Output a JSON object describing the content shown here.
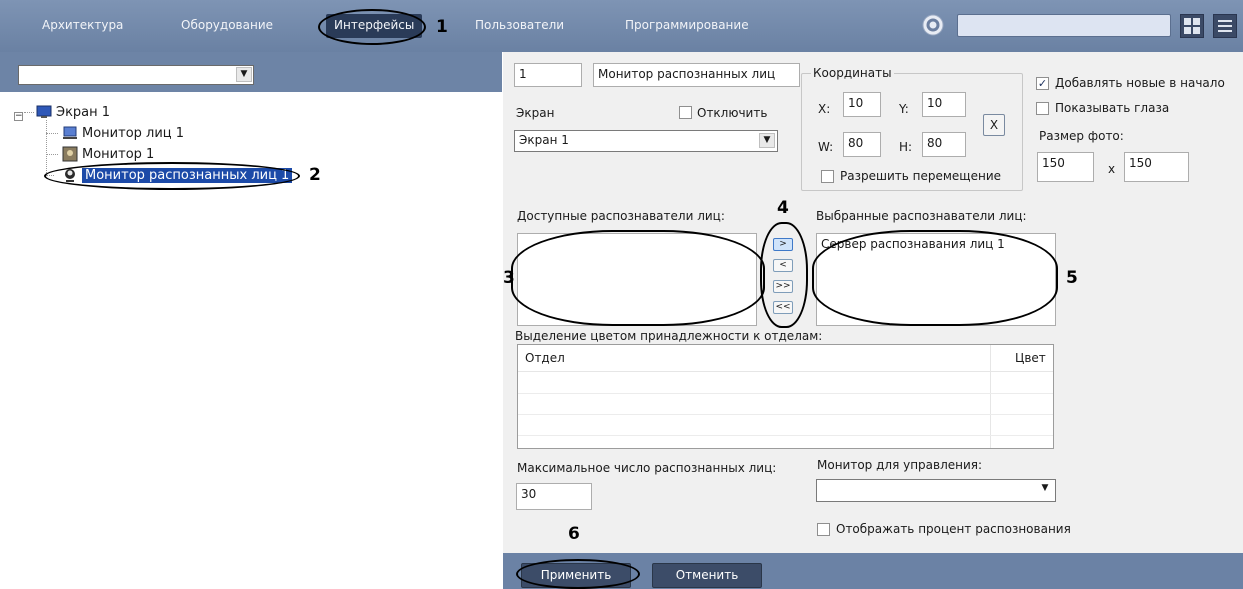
{
  "top_menu": {
    "items": [
      "Архитектура",
      "Оборудование",
      "Интерфейсы",
      "Пользователи",
      "Программирование"
    ],
    "active": "Интерфейсы",
    "search_value": ""
  },
  "tree": {
    "select_value": "",
    "nodes": [
      {
        "label": "Экран 1",
        "icon": "screen-icon"
      },
      {
        "label": "Монитор лиц 1",
        "icon": "monitor-icon"
      },
      {
        "label": "Монитор 1",
        "icon": "camera-monitor-icon"
      },
      {
        "label": "Монитор распознанных лиц 1",
        "icon": "face-monitor-icon"
      }
    ]
  },
  "settings": {
    "id_value": "1",
    "name_value": "Монитор распознанных лиц",
    "screen_label": "Экран",
    "disable_label": "Отключить",
    "screen_select": "Экран 1",
    "coords": {
      "group_label": "Координаты",
      "x_label": "X:",
      "x_value": "10",
      "y_label": "Y:",
      "y_value": "10",
      "w_label": "W:",
      "w_value": "80",
      "h_label": "H:",
      "h_value": "80",
      "reset_label": "X",
      "allow_move_label": "Разрешить перемещение"
    },
    "add_new_first_label": "Добавлять новые в начало",
    "add_new_first_checked": true,
    "show_eyes_label": "Показывать глаза",
    "photo_size_label": "Размер фото:",
    "photo_w": "150",
    "photo_x": "x",
    "photo_h": "150",
    "available_label": "Доступные распознаватели лиц:",
    "selected_label": "Выбранные распознаватели лиц:",
    "selected_items": [
      "Сервер распознавания лиц 1"
    ],
    "move_buttons": [
      ">",
      "<",
      ">>",
      "<<"
    ],
    "dept_color_label": "Выделение цветом принадлежности к отделам:",
    "dept_table": {
      "col_dept": "Отдел",
      "col_color": "Цвет"
    },
    "max_faces_label": "Максимальное число распознанных лиц:",
    "max_faces_value": "30",
    "control_monitor_label": "Монитор для управления:",
    "control_monitor_value": "",
    "show_percent_label": "Отображать процент распознования",
    "apply_label": "Применить",
    "cancel_label": "Отменить"
  },
  "annotations": [
    "1",
    "2",
    "3",
    "4",
    "5",
    "6"
  ]
}
